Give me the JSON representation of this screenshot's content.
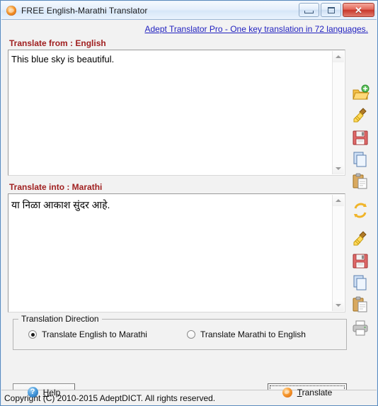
{
  "window": {
    "title": "FREE English-Marathi Translator",
    "icon": "globe-icon",
    "minimize_tooltip": "Minimize",
    "maximize_tooltip": "Maximize",
    "close_glyph": "✕"
  },
  "promo": {
    "link_text": "Adept Translator Pro - One key translation in 72 languages.",
    "color": "#1f1fbf"
  },
  "source": {
    "label": "Translate from : English",
    "text": "This blue sky is beautiful."
  },
  "target": {
    "label": "Translate into : Marathi",
    "text": "या निळा आकाश सुंदर आहे."
  },
  "toolbar_top": [
    {
      "name": "open-file-icon",
      "title": "Open"
    },
    {
      "name": "clear-broom-icon",
      "title": "Clear"
    },
    {
      "name": "save-icon",
      "title": "Save"
    },
    {
      "name": "copy-icon",
      "title": "Copy"
    },
    {
      "name": "paste-icon",
      "title": "Paste"
    },
    {
      "name": "swap-refresh-icon",
      "title": "Swap"
    }
  ],
  "toolbar_bottom": [
    {
      "name": "clear-broom-icon",
      "title": "Clear"
    },
    {
      "name": "save-icon",
      "title": "Save"
    },
    {
      "name": "copy-icon",
      "title": "Copy"
    },
    {
      "name": "paste-icon",
      "title": "Paste"
    },
    {
      "name": "print-icon",
      "title": "Print"
    }
  ],
  "direction": {
    "legend": "Translation Direction",
    "options": [
      {
        "label": "Translate English to Marathi",
        "checked": true
      },
      {
        "label": "Translate Marathi to English",
        "checked": false
      }
    ]
  },
  "buttons": {
    "help": {
      "label": "Help",
      "accel": "H",
      "icon": "help-question-icon"
    },
    "translate": {
      "label": "Translate",
      "accel": "T",
      "icon": "globe-icon",
      "focused": true
    }
  },
  "status": {
    "text": "Copyright (C) 2010-2015 AdeptDICT. All rights reserved."
  },
  "theme": {
    "label_color": "#a02020",
    "link_color": "#1f1fbf",
    "title_bar_start": "#f4f9fe",
    "title_bar_end": "#e9f2fd",
    "client_bg": "#f2f2f2",
    "close_button": "#c8382c"
  }
}
